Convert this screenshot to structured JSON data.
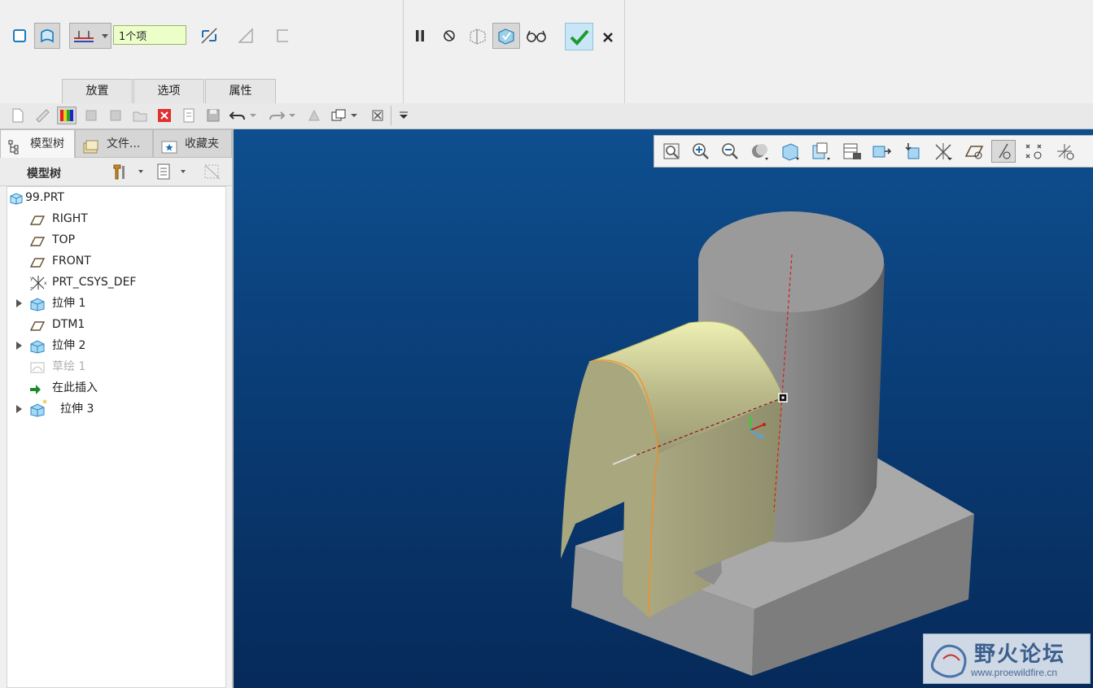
{
  "dashboard": {
    "selection_value": "1个项",
    "tabs": [
      {
        "label": "放置"
      },
      {
        "label": "选项"
      },
      {
        "label": "属性"
      }
    ],
    "icons": [
      "solid-icon",
      "surface-icon",
      "thicken-dropdown-icon",
      "flip-direction-icon",
      "remove-material-icon",
      "thicken-sketch-icon",
      "pause-icon",
      "no-preview-icon",
      "attach-preview-icon",
      "verify-preview-icon",
      "glasses-preview-icon",
      "ok-check-icon",
      "cancel-x-icon"
    ]
  },
  "left_panel": {
    "tabs": [
      {
        "label": "模型树"
      },
      {
        "label": "文件..."
      },
      {
        "label": "收藏夹"
      }
    ],
    "tree_header": "模型树",
    "tree_items": [
      {
        "label": "99.PRT",
        "icon": "part-icon",
        "expandable": false,
        "dimmed": false
      },
      {
        "label": "RIGHT",
        "icon": "datum-plane-icon",
        "expandable": false,
        "dimmed": false
      },
      {
        "label": "TOP",
        "icon": "datum-plane-icon",
        "expandable": false,
        "dimmed": false
      },
      {
        "label": "FRONT",
        "icon": "datum-plane-icon",
        "expandable": false,
        "dimmed": false
      },
      {
        "label": "PRT_CSYS_DEF",
        "icon": "csys-icon",
        "expandable": false,
        "dimmed": false
      },
      {
        "label": "拉伸 1",
        "icon": "extrude-icon",
        "expandable": true,
        "dimmed": false
      },
      {
        "label": "DTM1",
        "icon": "datum-plane-icon",
        "expandable": false,
        "dimmed": false
      },
      {
        "label": "拉伸 2",
        "icon": "extrude-icon",
        "expandable": true,
        "dimmed": false
      },
      {
        "label": "草绘 1",
        "icon": "sketch-icon",
        "expandable": false,
        "dimmed": true
      },
      {
        "label": "在此插入",
        "icon": "insert-here-arrow-icon",
        "expandable": false,
        "dimmed": false
      },
      {
        "label": "拉伸 3",
        "icon": "extrude-active-icon",
        "expandable": true,
        "dimmed": false
      }
    ]
  },
  "watermark": {
    "title": "野火论坛",
    "url": "www.proewildfire.cn"
  },
  "colors": {
    "viewport_top": "#0e4f8f",
    "viewport_bottom": "#062a5a",
    "surface_preview": "#e6e7a6",
    "model_gray": "#8c8c8c",
    "selection_field": "#ecffc9"
  }
}
